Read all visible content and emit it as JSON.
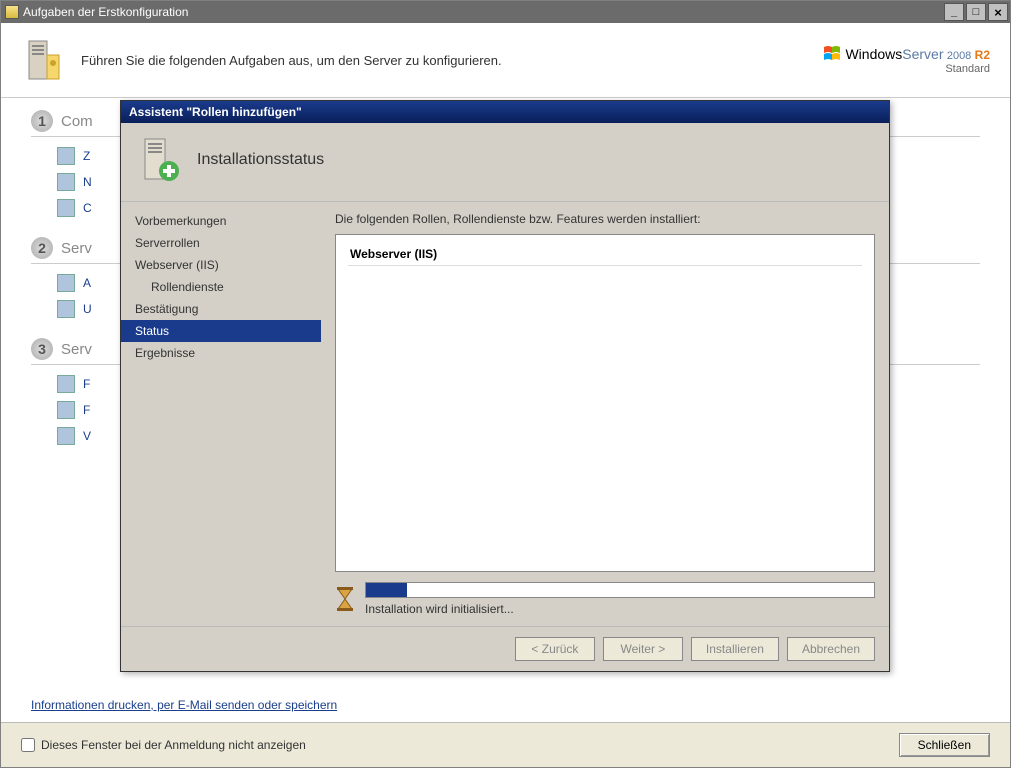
{
  "outer": {
    "title": "Aufgaben der Erstkonfiguration"
  },
  "header": {
    "text": "Führen Sie die folgenden Aufgaben aus, um den Server zu konfigurieren.",
    "brand_windows": "Windows",
    "brand_server": "Server",
    "brand_year": "2008",
    "brand_r2": "R2",
    "brand_edition": "Standard"
  },
  "background": {
    "sections": [
      {
        "num": "1",
        "title": "Com"
      },
      {
        "num": "2",
        "title": "Serv"
      },
      {
        "num": "3",
        "title": "Serv"
      }
    ],
    "items": [
      "Z",
      "N",
      "C",
      "A",
      "U",
      "F",
      "F",
      "V"
    ],
    "info_link": "Informationen drucken, per E-Mail senden oder speichern"
  },
  "bottom": {
    "checkbox_label": "Dieses Fenster bei der Anmeldung nicht anzeigen",
    "close_label": "Schließen"
  },
  "wizard": {
    "title": "Assistent \"Rollen hinzufügen\"",
    "header": "Installationsstatus",
    "nav": [
      {
        "label": "Vorbemerkungen",
        "sub": false,
        "active": false
      },
      {
        "label": "Serverrollen",
        "sub": false,
        "active": false
      },
      {
        "label": "Webserver (IIS)",
        "sub": false,
        "active": false
      },
      {
        "label": "Rollendienste",
        "sub": true,
        "active": false
      },
      {
        "label": "Bestätigung",
        "sub": false,
        "active": false
      },
      {
        "label": "Status",
        "sub": false,
        "active": true
      },
      {
        "label": "Ergebnisse",
        "sub": false,
        "active": false
      }
    ],
    "main_desc": "Die folgenden Rollen, Rollendienste bzw. Features werden installiert:",
    "role": "Webserver (IIS)",
    "progress_text": "Installation wird initialisiert...",
    "buttons": {
      "back": "< Zurück",
      "next": "Weiter >",
      "install": "Installieren",
      "cancel": "Abbrechen"
    }
  }
}
